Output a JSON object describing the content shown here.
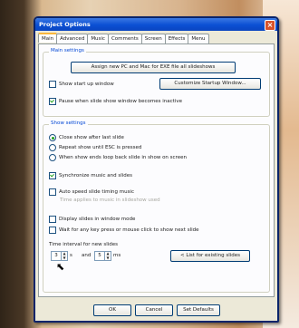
{
  "dialog": {
    "title": "Project Options",
    "close_glyph": "×",
    "tabs": [
      "Main",
      "Advanced",
      "Music",
      "Comments",
      "Screen",
      "Effects",
      "Menu"
    ],
    "playback_settings": {
      "legend": "Main settings",
      "assign_button": "Assign new PC and Mac for EXE file all slideshows",
      "show_startup_label": "Show start up window",
      "customize_button": "Customize Startup Window...",
      "pause_label": "Pause when slide show window becomes inactive"
    },
    "show_settings": {
      "legend": "Show settings",
      "radio_close": "Close show after last slide",
      "radio_repeat": "Repeat show until ESC is pressed",
      "radio_loop": "When show ends loop back slide in show on screen",
      "sync_label": "Synchronize music and slides",
      "auto_speed_label": "Auto speed slide timing music",
      "auto_speed_note": "Time applies to music in slideshow used",
      "display_window_label": "Display slides in window mode",
      "wait_label": "Wait for any key press or mouse click to show next slide",
      "time_interval_label": "Time interval for new slides",
      "spin1_value": "3",
      "spin1_unit": "s",
      "and_label": "and",
      "spin2_value": "5",
      "spin2_unit": "ms",
      "list_button": "< List for existing slides"
    },
    "footer": {
      "ok": "OK",
      "cancel": "Cancel",
      "defaults": "Set Defaults"
    }
  }
}
